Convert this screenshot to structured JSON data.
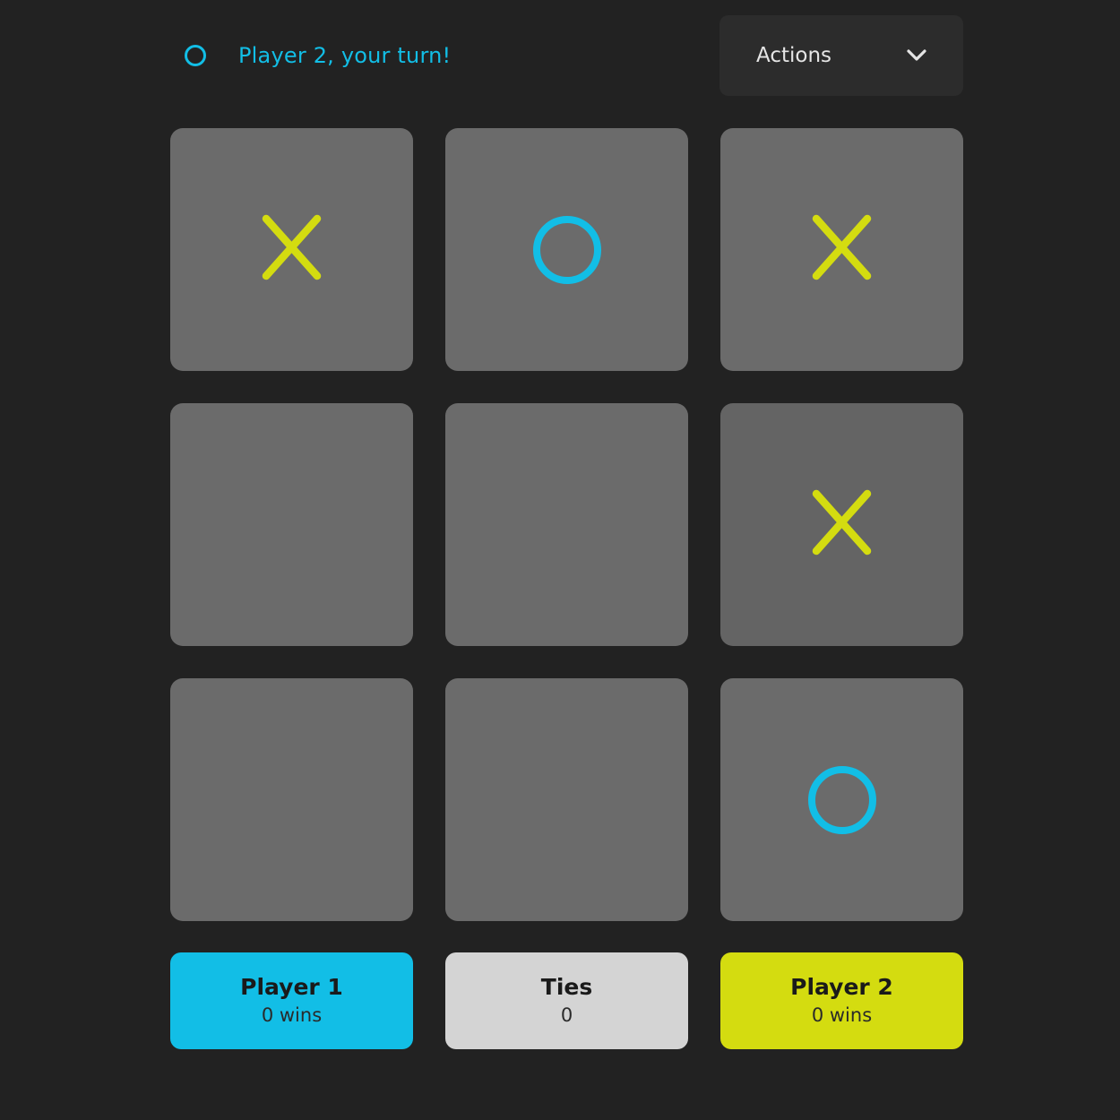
{
  "header": {
    "turn_icon": "o-icon",
    "turn_text": "Player 2, your turn!",
    "actions_label": "Actions",
    "actions_icon": "chevron-down-icon"
  },
  "board": {
    "cells": [
      "X",
      "O",
      "X",
      "",
      "",
      "X",
      "",
      "",
      "O"
    ]
  },
  "scores": {
    "player1": {
      "title": "Player 1",
      "value": "0 wins"
    },
    "ties": {
      "title": "Ties",
      "value": "0"
    },
    "player2": {
      "title": "Player 2",
      "value": "0 wins"
    }
  },
  "colors": {
    "background": "#222222",
    "cell": "#6b6b6b",
    "x_mark": "#d4dc10",
    "o_mark": "#12bee6",
    "player1": "#12bee6",
    "ties": "#d4d4d4",
    "player2": "#d4dc10"
  }
}
